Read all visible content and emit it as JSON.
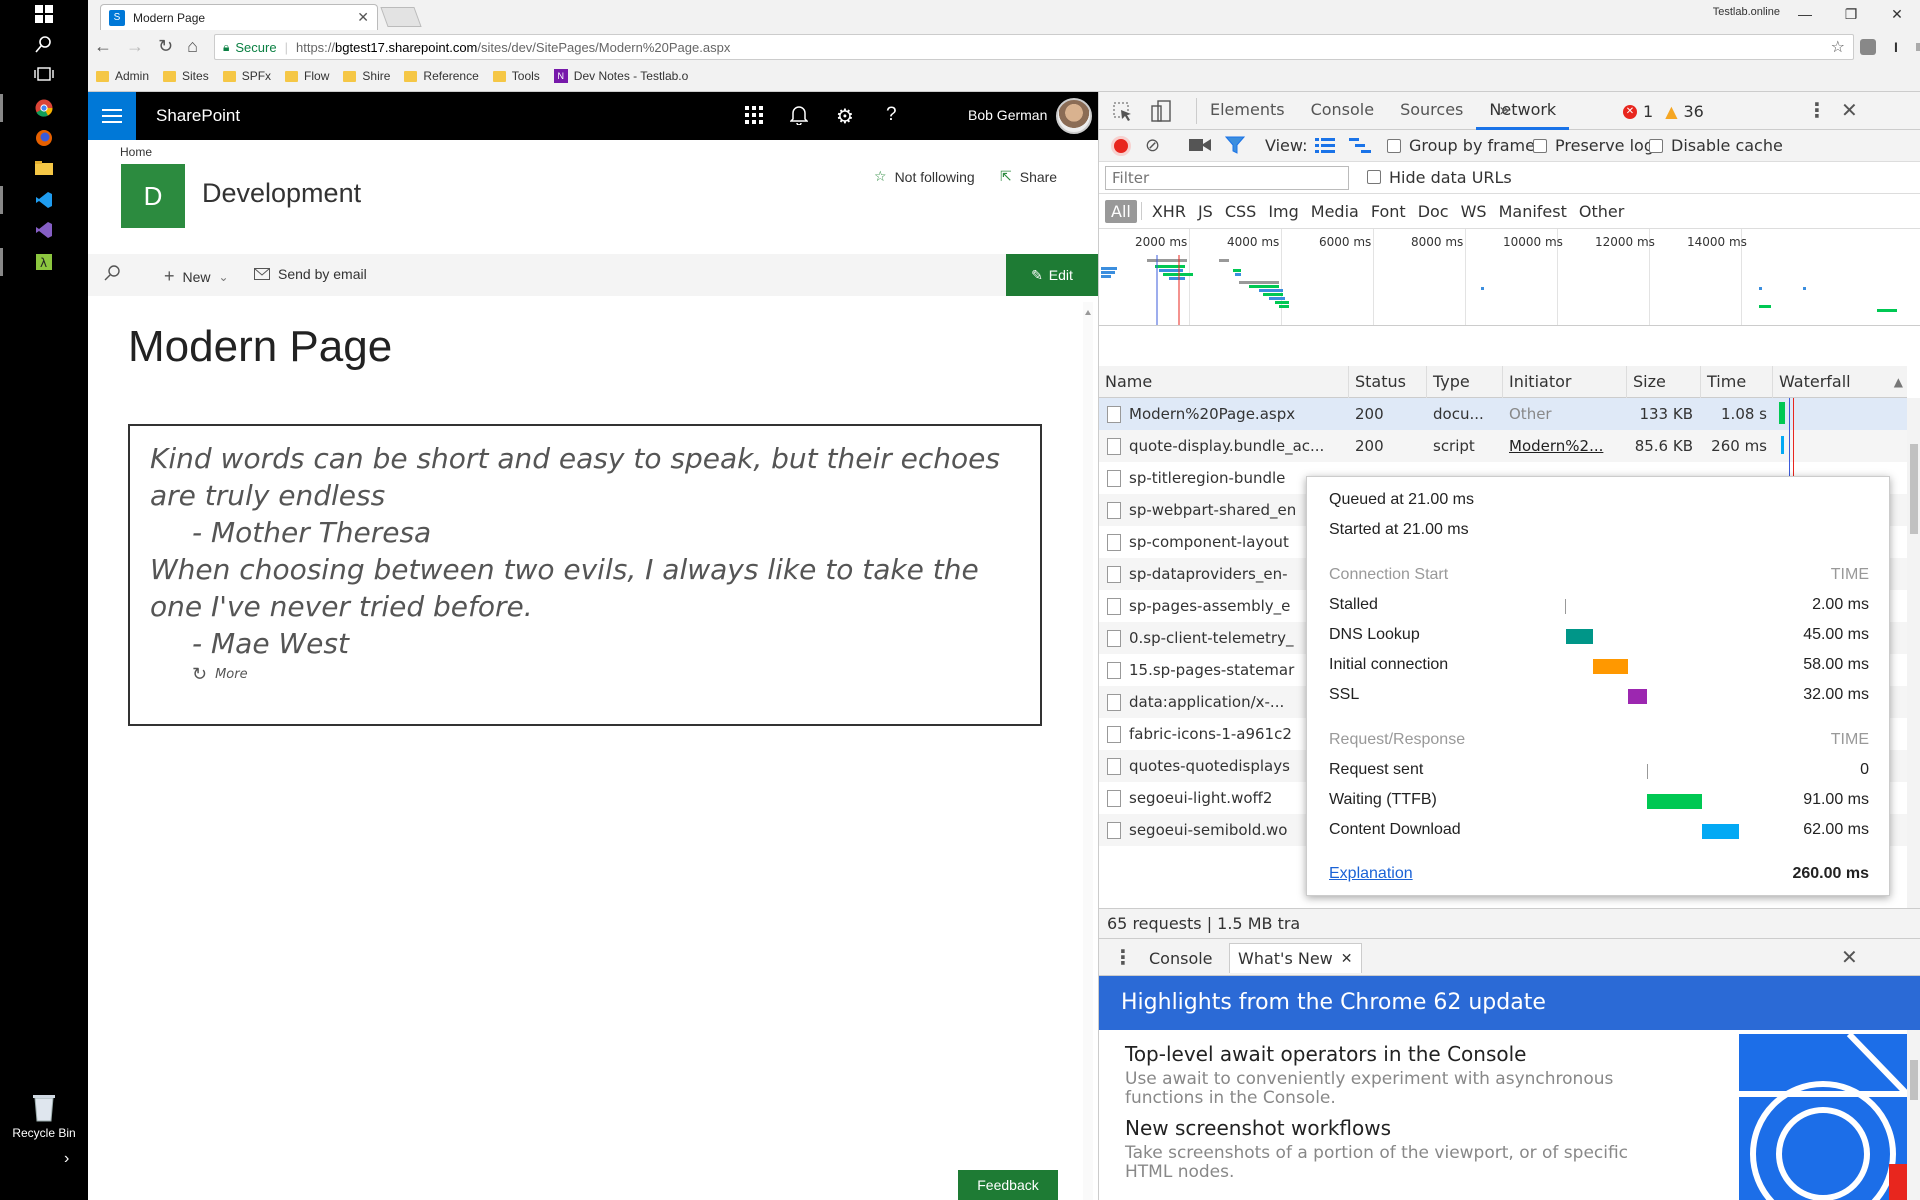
{
  "browser": {
    "tab_title": "Modern Page",
    "profile_label": "Testlab.online",
    "secure_label": "Secure",
    "url_prefix": "https://",
    "url_host": "bgtest17.sharepoint.com",
    "url_path": "/sites/dev/SitePages/Modern%20Page.aspx",
    "bookmarks": [
      "Admin",
      "Sites",
      "SPFx",
      "Flow",
      "Shire",
      "Reference",
      "Tools",
      "Dev Notes - Testlab.o"
    ]
  },
  "desktop": {
    "recycle_bin": "Recycle Bin"
  },
  "sharepoint": {
    "app_name": "SharePoint",
    "user_name": "Bob German",
    "breadcrumb": "Home",
    "site_logo_letter": "D",
    "site_title": "Development",
    "follow_label": "Not following",
    "share_label": "Share",
    "new_label": "New",
    "send_email_label": "Send by email",
    "edit_label": "Edit",
    "page_title": "Modern Page",
    "quotes": [
      {
        "text": "Kind words can be short and easy to speak, but their echoes are truly endless",
        "author": "- Mother Theresa"
      },
      {
        "text": "When choosing between two evils, I always like to take the one I've never tried before.",
        "author": "- Mae West"
      }
    ],
    "more_label": "More",
    "feedback_label": "Feedback",
    "colors": {
      "suite": "#000000",
      "waffle": "#0078d7",
      "site_logo": "#2c8b3f",
      "edit": "#1e7b34"
    }
  },
  "devtools": {
    "tabs": [
      "Elements",
      "Console",
      "Sources",
      "Network"
    ],
    "active_tab": "Network",
    "more_tabs": "»",
    "error_count": "1",
    "warning_count": "36",
    "view_label": "View:",
    "group_by_frame": "Group by frame",
    "preserve_log": "Preserve log",
    "disable_cache": "Disable cache",
    "filter_placeholder": "Filter",
    "hide_data_urls": "Hide data URLs",
    "filter_types": [
      "All",
      "XHR",
      "JS",
      "CSS",
      "Img",
      "Media",
      "Font",
      "Doc",
      "WS",
      "Manifest",
      "Other"
    ],
    "timeline_ticks": [
      "2000 ms",
      "4000 ms",
      "6000 ms",
      "8000 ms",
      "10000 ms",
      "12000 ms",
      "14000 ms"
    ],
    "columns": [
      "Name",
      "Status",
      "Type",
      "Initiator",
      "Size",
      "Time",
      "Waterfall"
    ],
    "requests": [
      {
        "name": "Modern%20Page.aspx",
        "status": "200",
        "type": "docu...",
        "initiator": "Other",
        "size": "133 KB",
        "time": "1.08 s"
      },
      {
        "name": "quote-display.bundle_ac...",
        "status": "200",
        "type": "script",
        "initiator": "Modern%2...",
        "size": "85.6 KB",
        "time": "260 ms"
      },
      {
        "name": "sp-titleregion-bundle"
      },
      {
        "name": "sp-webpart-shared_en"
      },
      {
        "name": "sp-component-layout"
      },
      {
        "name": "sp-dataproviders_en-"
      },
      {
        "name": "sp-pages-assembly_e"
      },
      {
        "name": "0.sp-client-telemetry_"
      },
      {
        "name": "15.sp-pages-statemar"
      },
      {
        "name": "data:application/x-..."
      },
      {
        "name": "fabric-icons-1-a961c2"
      },
      {
        "name": "quotes-quotedisplays"
      },
      {
        "name": "segoeui-light.woff2"
      },
      {
        "name": "segoeui-semibold.wo"
      }
    ],
    "summary": "65 requests | 1.5 MB tra",
    "timing": {
      "queued": "Queued at 21.00 ms",
      "started": "Started at 21.00 ms",
      "section1": "Connection Start",
      "section2": "Request/Response",
      "time_hdr": "TIME",
      "rows1": [
        {
          "label": "Stalled",
          "value": "2.00 ms",
          "color": "#999999"
        },
        {
          "label": "DNS Lookup",
          "value": "45.00 ms",
          "color": "#009688"
        },
        {
          "label": "Initial connection",
          "value": "58.00 ms",
          "color": "#ff9800"
        },
        {
          "label": "SSL",
          "value": "32.00 ms",
          "color": "#9c27b0"
        }
      ],
      "rows2": [
        {
          "label": "Request sent",
          "value": "0",
          "color": "#999999"
        },
        {
          "label": "Waiting (TTFB)",
          "value": "91.00 ms",
          "color": "#00c853"
        },
        {
          "label": "Content Download",
          "value": "62.00 ms",
          "color": "#03a9f4"
        }
      ],
      "explanation": "Explanation",
      "total": "260.00 ms"
    },
    "drawer_tabs": [
      "Console",
      "What's New"
    ],
    "whatsnew_title": "Highlights from the Chrome 62 update",
    "whatsnew_items": [
      {
        "title": "Top-level await operators in the Console",
        "desc": "Use await to conveniently experiment with asynchronous functions in the Console."
      },
      {
        "title": "New screenshot workflows",
        "desc": "Take screenshots of a portion of the viewport, or of specific HTML nodes."
      }
    ],
    "colors": {
      "accent": "#1a73e8",
      "banner": "#2b6ad6",
      "record": "#e8261e"
    }
  }
}
